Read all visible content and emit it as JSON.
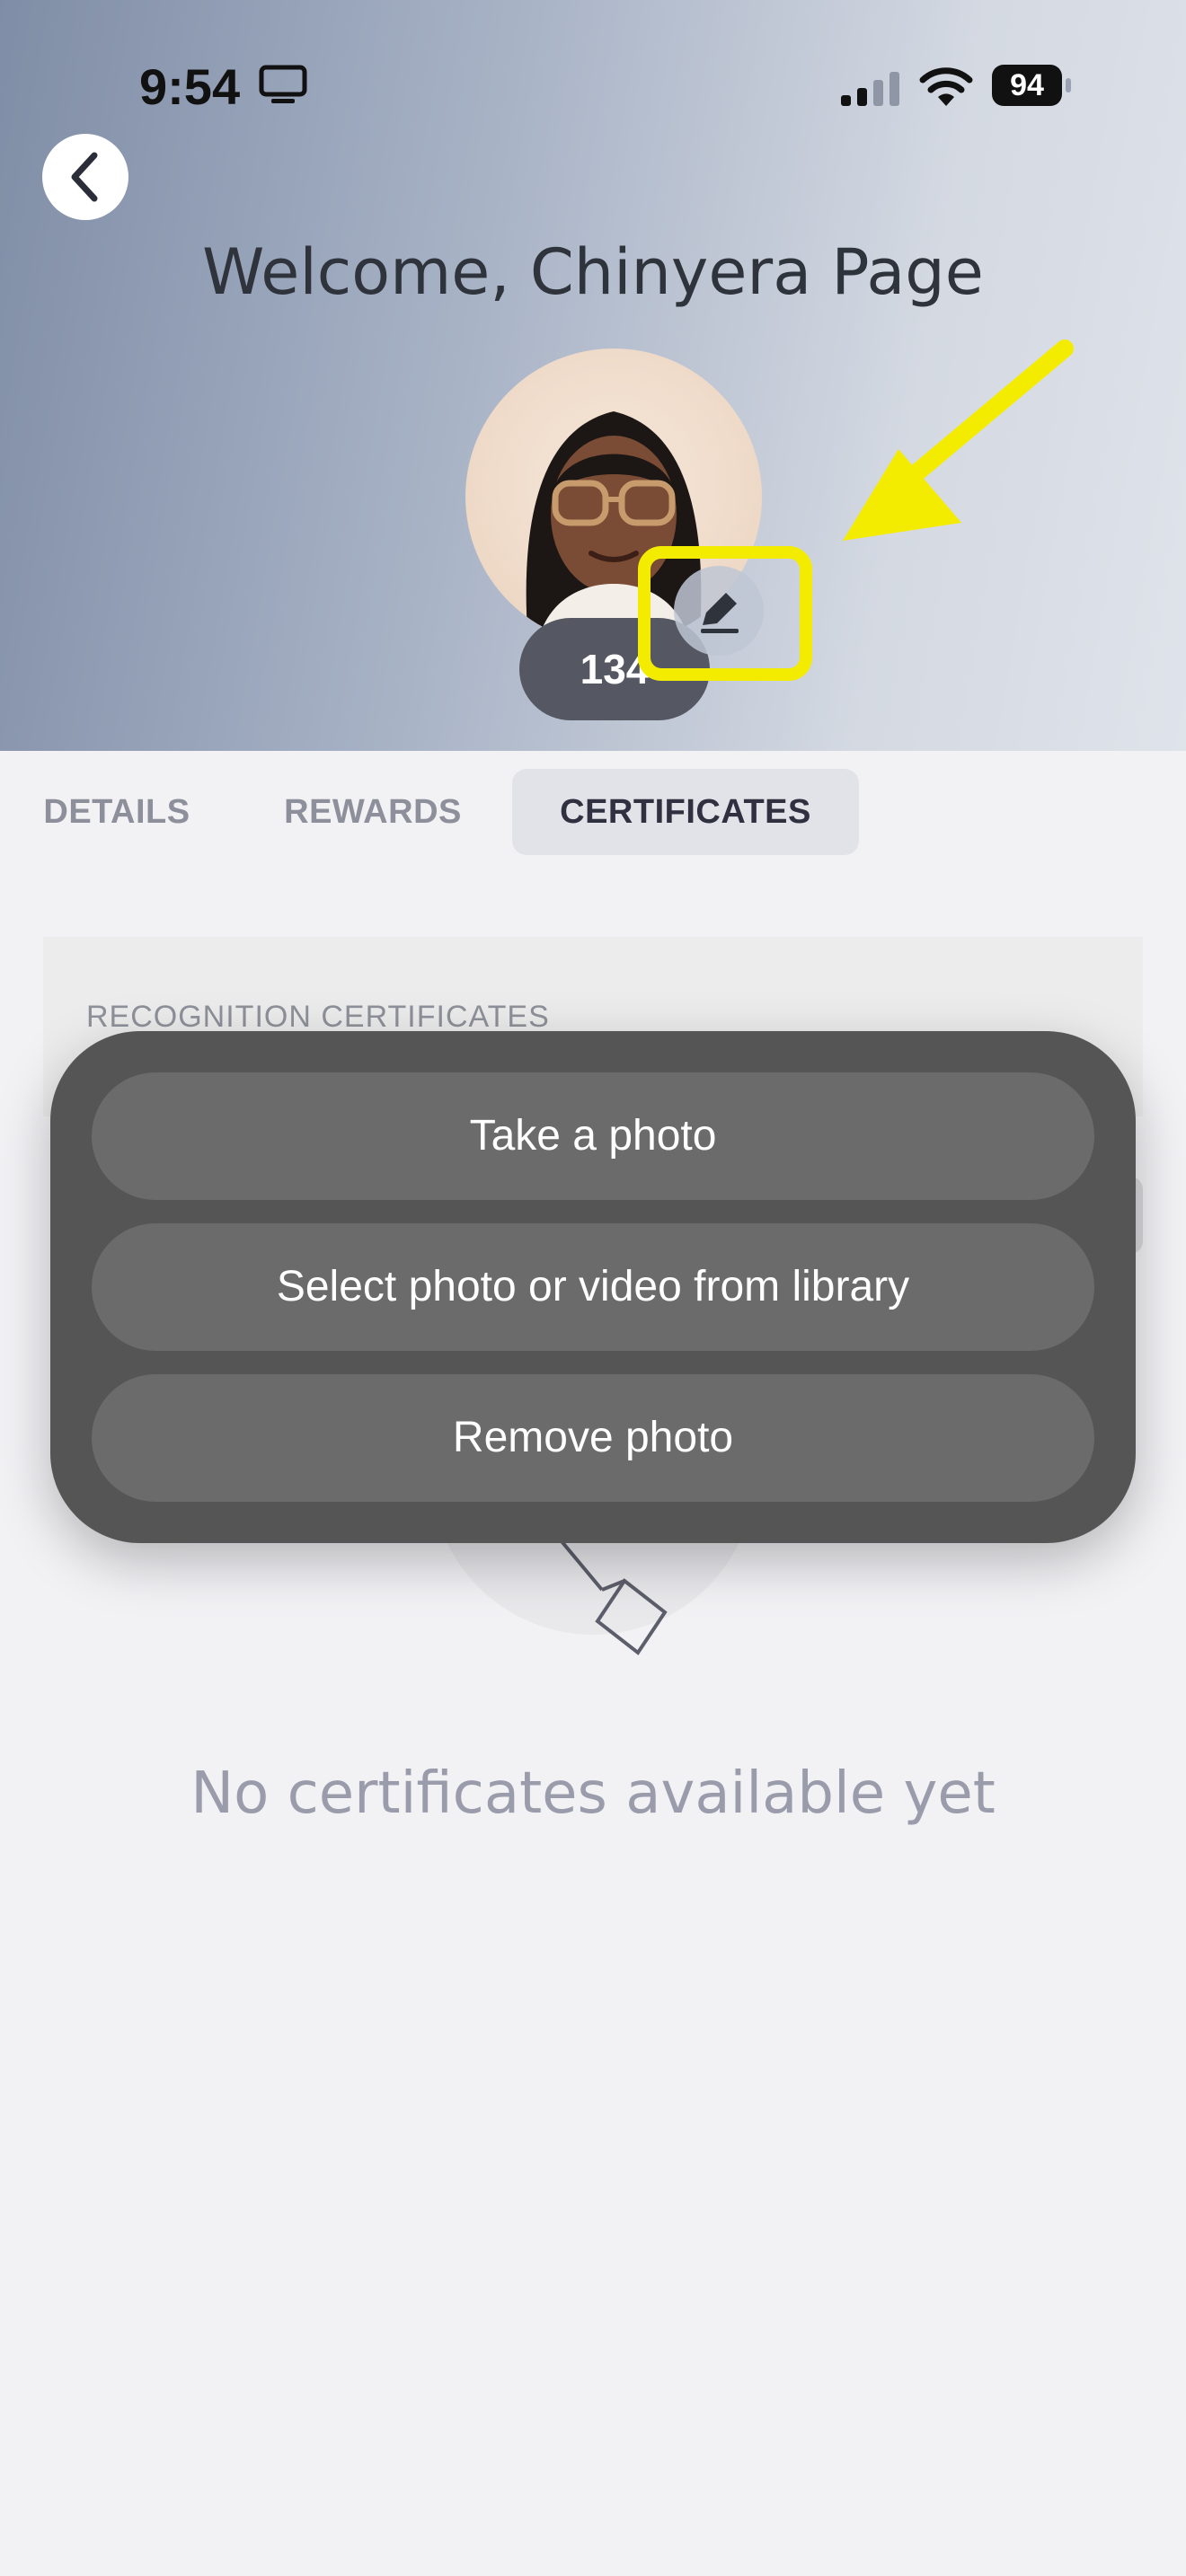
{
  "status_bar": {
    "time": "9:54",
    "battery": "94"
  },
  "header": {
    "title": "Welcome, Chinyera Page",
    "points": "134"
  },
  "tabs": [
    "DETAILS",
    "REWARDS",
    "CERTIFICATES"
  ],
  "selected_tab": "CERTIFICATES",
  "card": {
    "label": "RECOGNITION CERTIFICATES"
  },
  "empty_state": {
    "text": "No certificates available yet"
  },
  "action_sheet": {
    "options": [
      "Take a photo",
      "Select photo or video from library",
      "Remove photo"
    ]
  },
  "colors": {
    "highlight": "#f4ec00",
    "sheet": "#555555",
    "badge": "#555862"
  },
  "icons": [
    "back-chevron-icon",
    "pencil-icon",
    "tv-icon",
    "signal-icon",
    "wifi-icon"
  ]
}
